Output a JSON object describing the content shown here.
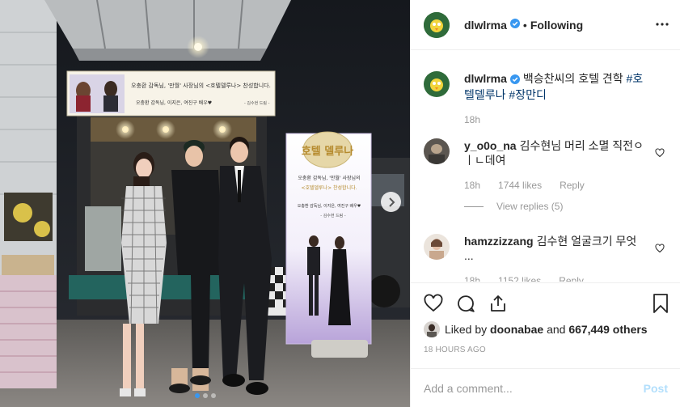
{
  "header": {
    "username": "dlwlrma",
    "separator": "•",
    "follow_label": "Following"
  },
  "caption": {
    "username": "dlwlrma",
    "text": "백승찬씨의 호텔 견학",
    "hashtags": [
      "#호텔델루나",
      "#장만디"
    ],
    "age": "18h"
  },
  "comments": [
    {
      "username": "y_o0o_na",
      "text": "김수현님 머리 소멸 직전ㅇㅣㄴ데여",
      "age": "18h",
      "likes": "1744 likes",
      "reply_label": "Reply",
      "view_replies": "View replies (5)"
    },
    {
      "username": "hamzzizzang",
      "text": "김수현 얼굴크기 무엇 ...",
      "age": "18h",
      "likes": "1152 likes",
      "reply_label": "Reply"
    }
  ],
  "likes": {
    "prefix": "Liked by",
    "first_user": "doonabae",
    "conjunction": "and",
    "others": "667,449 others"
  },
  "timestamp": "18 HOURS AGO",
  "add_comment": {
    "placeholder": "Add a comment...",
    "post_label": "Post"
  },
  "media": {
    "banner_line1": "오충환 감독님, '만월' 사장님의 <호텔델루나> 찬성합니다.",
    "banner_line2": "오충환 감독님, 이지은, 여진구 배우♥",
    "banner_line3": "- 김수현 드림 -",
    "standee_title": "호텔 델루나",
    "standee_line1": "오충환 감독님, '만월' 사장님의",
    "standee_line2": "<호텔델루나> 찬성합니다.",
    "standee_line3": "오충환 감독님, 이지은, 여진구 배우♥",
    "standee_line4": "- 김수현 드림 -",
    "carousel": {
      "total": 3,
      "active": 1
    }
  },
  "colors": {
    "link": "#003569",
    "verified": "#3897f0",
    "muted": "#999999",
    "post_disabled": "#b2dffc",
    "active_dot": "#3897f0"
  },
  "icons": [
    "verified-badge-icon",
    "more-options-icon",
    "heart-icon",
    "comment-icon",
    "share-icon",
    "bookmark-icon",
    "next-arrow-icon"
  ]
}
